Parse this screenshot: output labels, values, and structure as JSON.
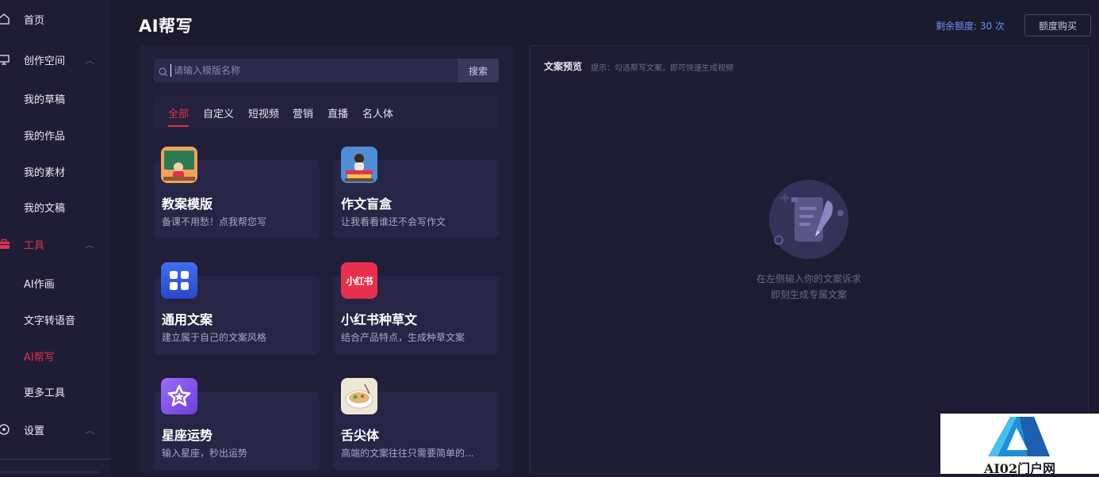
{
  "sidebar": {
    "home": "首页",
    "workspace": {
      "label": "创作空间",
      "items": [
        "我的草稿",
        "我的作品",
        "我的素材",
        "我的文稿"
      ]
    },
    "tools": {
      "label": "工具",
      "items": [
        "AI作画",
        "文字转语音",
        "AI帮写",
        "更多工具"
      ],
      "active_item": "AI帮写"
    },
    "settings": "设置"
  },
  "header": {
    "title": "AI帮写",
    "quota_label": "剩余额度: 30 次",
    "buy_button": "额度购买"
  },
  "search": {
    "placeholder": "请输入模版名称",
    "button": "搜索"
  },
  "tabs": [
    "全部",
    "自定义",
    "短视频",
    "营销",
    "直播",
    "名人体"
  ],
  "active_tab": "全部",
  "templates": [
    {
      "title": "教案模版",
      "desc": "备课不用愁！点我帮您写",
      "icon": "classroom-teacher-icon"
    },
    {
      "title": "作文盲盒",
      "desc": "让我看看谁还不会写作文",
      "icon": "books-reading-icon"
    },
    {
      "title": "通用文案",
      "desc": "建立属于自己的文案风格",
      "icon": "grid-apps-icon"
    },
    {
      "title": "小红书种草文",
      "desc": "结合产品特点，生成种草文案",
      "icon": "xiaohongshu-logo-icon",
      "icon_text": "小红书"
    },
    {
      "title": "星座运势",
      "desc": "输入星座，秒出运势",
      "icon": "star-icon"
    },
    {
      "title": "舌尖体",
      "desc": "高端的文案往往只需要简单的...",
      "icon": "food-bowl-icon"
    }
  ],
  "preview": {
    "title": "文案预览",
    "hint": "提示：勾选帮写文案，即可快速生成视频",
    "empty_line1": "在左侧输入你的文案诉求",
    "empty_line2": "即刻生成专属文案"
  },
  "watermark": {
    "text": "AI02门户网"
  },
  "colors": {
    "accent": "#e0334f",
    "quota": "#6f8ff2",
    "background": "#1b1a2e"
  }
}
